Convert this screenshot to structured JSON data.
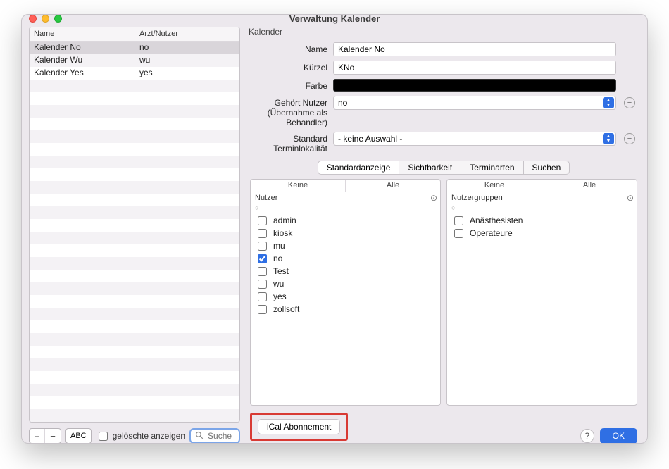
{
  "window": {
    "title": "Verwaltung Kalender"
  },
  "left_table": {
    "headers": {
      "name": "Name",
      "user": "Arzt/Nutzer"
    },
    "rows": [
      {
        "name": "Kalender No",
        "user": "no",
        "selected": true
      },
      {
        "name": "Kalender Wu",
        "user": "wu",
        "selected": false
      },
      {
        "name": "Kalender Yes",
        "user": "yes",
        "selected": false
      }
    ],
    "blank_rows": 27
  },
  "left_controls": {
    "abc": "ABC",
    "show_deleted": "gelöschte anzeigen",
    "search_placeholder": "Suche"
  },
  "form": {
    "group_label": "Kalender",
    "name_label": "Name",
    "name_value": "Kalender No",
    "short_label": "Kürzel",
    "short_value": "KNo",
    "color_label": "Farbe",
    "owner_label": "Gehört Nutzer (Übernahme als Behandler)",
    "owner_value": "no",
    "locality_label": "Standard Terminlokalität",
    "locality_value": "- keine Auswahl -"
  },
  "tabs": {
    "items": [
      "Standardanzeige",
      "Sichtbarkeit",
      "Terminarten",
      "Suchen"
    ],
    "active": 0
  },
  "panes": {
    "none": "Keine",
    "all": "Alle",
    "users_label": "Nutzer",
    "groups_label": "Nutzergruppen",
    "users": [
      {
        "label": "admin",
        "checked": false
      },
      {
        "label": "kiosk",
        "checked": false
      },
      {
        "label": "mu",
        "checked": false
      },
      {
        "label": "no",
        "checked": true
      },
      {
        "label": "Test",
        "checked": false
      },
      {
        "label": "wu",
        "checked": false
      },
      {
        "label": "yes",
        "checked": false
      },
      {
        "label": "zollsoft",
        "checked": false
      }
    ],
    "groups": [
      {
        "label": "Anästhesisten",
        "checked": false
      },
      {
        "label": "Operateure",
        "checked": false
      }
    ]
  },
  "ical_button": "iCal Abonnement",
  "footer": {
    "ok": "OK",
    "help": "?"
  }
}
